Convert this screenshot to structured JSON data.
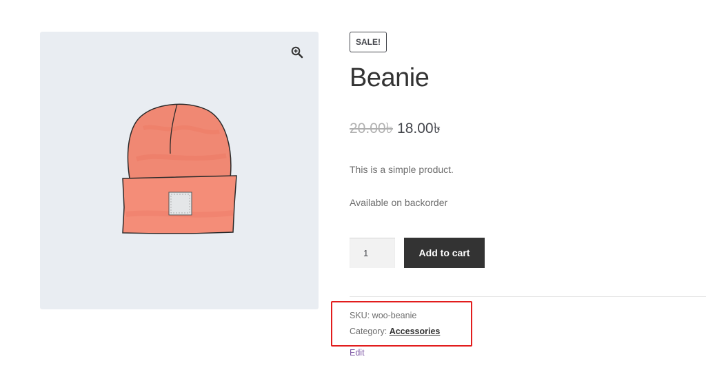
{
  "product": {
    "badge": "SALE!",
    "title": "Beanie",
    "regular_price": "20.00৳",
    "sale_price": "18.00৳",
    "description": "This is a simple product.",
    "stock_status": "Available on backorder",
    "quantity": "1",
    "add_to_cart_label": "Add to cart",
    "sku_label": "SKU:",
    "sku_value": "woo-beanie",
    "category_label": "Category:",
    "category_value": "Accessories",
    "edit_label": "Edit"
  },
  "gallery": {
    "zoom_icon": "zoom-in-icon",
    "image_subject": "beanie-hat"
  },
  "colors": {
    "hat": "#f08873",
    "highlight": "#e21d1d",
    "button": "#333333",
    "edit_link": "#7e58a5"
  }
}
